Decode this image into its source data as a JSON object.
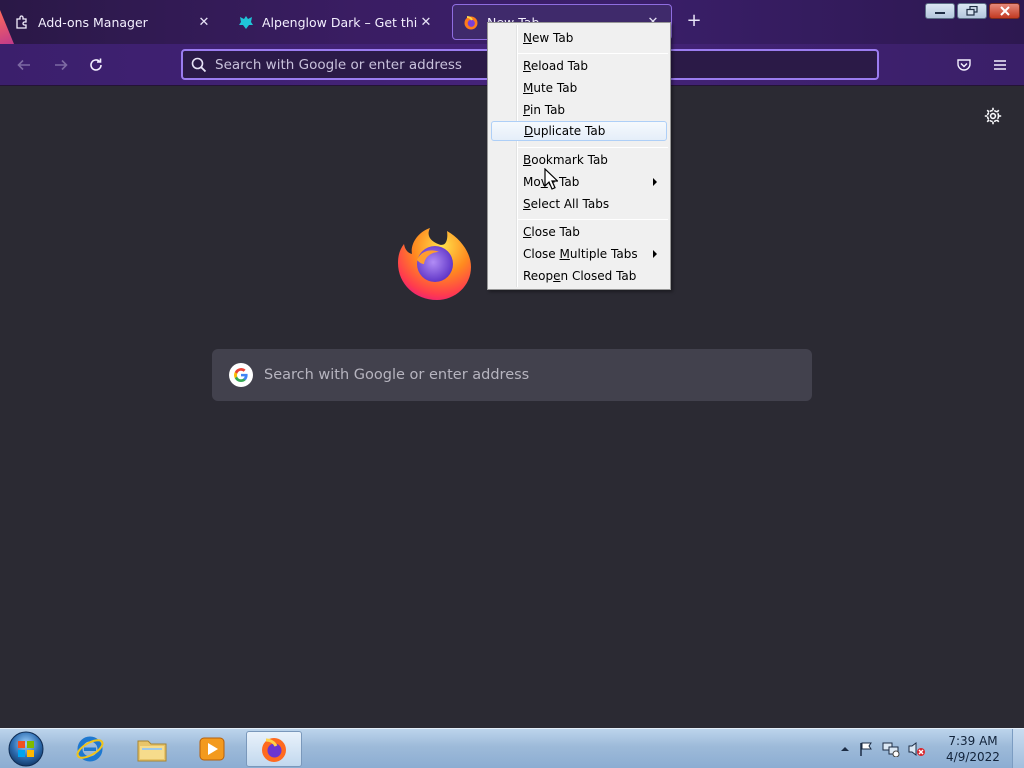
{
  "window": {
    "tabs": [
      {
        "label": "Add-ons Manager",
        "icon": "puzzle-icon"
      },
      {
        "label": "Alpenglow Dark – Get this Them",
        "icon": "addon-theme-icon"
      },
      {
        "label": "New Tab",
        "icon": "firefox-icon",
        "active": true
      }
    ],
    "new_tab_symbol": "+",
    "close_symbol": "✕"
  },
  "navbar": {
    "url_placeholder": "Search with Google or enter address"
  },
  "content": {
    "search_placeholder": "Search with Google or enter address"
  },
  "context_menu": {
    "items": [
      {
        "pre": "",
        "u": "N",
        "post": "ew Tab"
      },
      {
        "pre": "",
        "u": "R",
        "post": "eload Tab"
      },
      {
        "pre": "",
        "u": "M",
        "post": "ute Tab"
      },
      {
        "pre": "",
        "u": "P",
        "post": "in Tab"
      },
      {
        "pre": "",
        "u": "D",
        "post": "uplicate Tab"
      },
      {
        "pre": "",
        "u": "B",
        "post": "ookmark Tab"
      },
      {
        "pre": "Mo",
        "u": "v",
        "post": "e Tab",
        "submenu": true
      },
      {
        "pre": "",
        "u": "S",
        "post": "elect All Tabs"
      },
      {
        "pre": "",
        "u": "C",
        "post": "lose Tab"
      },
      {
        "pre": "Close ",
        "u": "M",
        "post": "ultiple Tabs",
        "submenu": true
      },
      {
        "pre": "Reop",
        "u": "e",
        "post": "n Closed Tab"
      }
    ],
    "hovered_item": "Duplicate Tab"
  },
  "taskbar": {
    "time": "7:39 AM",
    "date": "4/9/2022",
    "apps": [
      "internet-explorer-icon",
      "file-explorer-icon",
      "media-player-icon",
      "firefox-icon"
    ]
  },
  "colors": {
    "accent": "#9b7cf0",
    "content_bg": "#2b2a33",
    "search_bg": "#42414d"
  }
}
